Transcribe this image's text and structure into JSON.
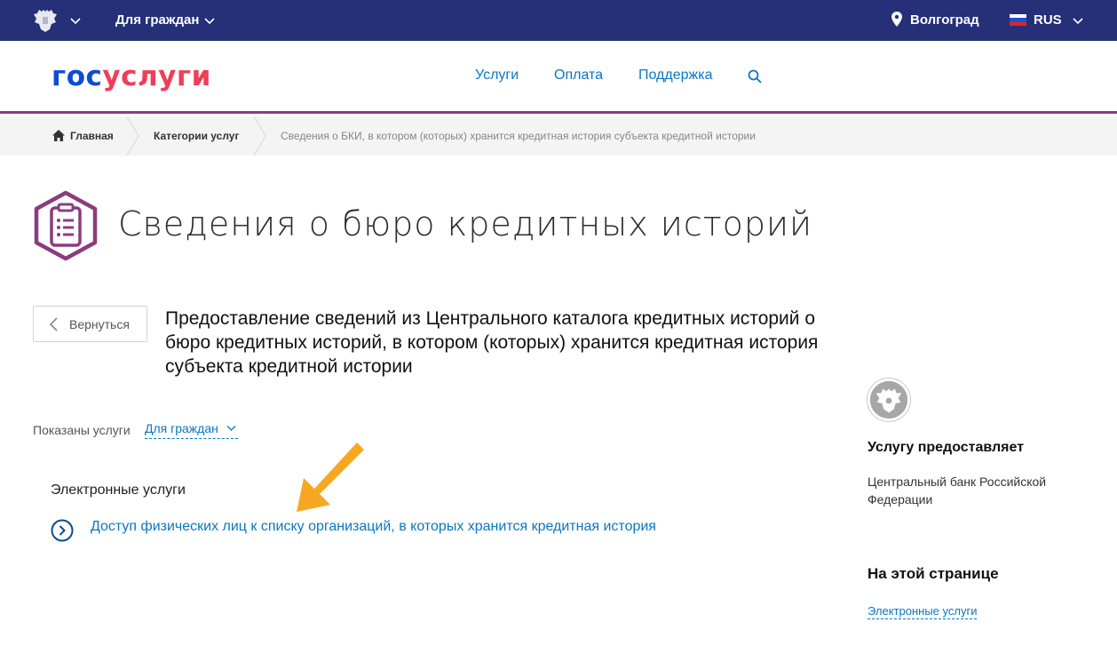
{
  "topbar": {
    "audience": "Для граждан",
    "location": "Волгоград",
    "language": "RUS"
  },
  "header": {
    "logo_part1": "гос",
    "logo_part2": "услуги",
    "nav": [
      "Услуги",
      "Оплата",
      "Поддержка"
    ]
  },
  "breadcrumbs": {
    "home": "Главная",
    "categories": "Категории услуг",
    "current": "Сведения о БКИ, в котором (которых) хранится кредитная история субъекта кредитной истории"
  },
  "page": {
    "title": "Сведения о бюро кредитных историй",
    "back_label": "Вернуться",
    "service_title": "Предоставление сведений из Центрального каталога кредитных историй о бюро кредитных историй, в котором (которых) хранится кредитная история субъекта кредитной истории",
    "shown_label": "Показаны услуги",
    "shown_value": "Для граждан",
    "section_heading": "Электронные услуги",
    "service_link": "Доступ физических лиц к списку организаций, в которых хранится кредитная история"
  },
  "sidebar": {
    "provider_heading": "Услугу предоставляет",
    "provider_name": "Центральный банк Российской Федерации",
    "on_page_heading": "На этой странице",
    "on_page_link": "Электронные услуги"
  },
  "colors": {
    "topbar": "#253078",
    "accent_purple": "#8c3c7e",
    "link_blue": "#0b76c2",
    "logo_blue": "#0d4cd3",
    "logo_red": "#ee3f58",
    "arrow_orange": "#f7a823"
  },
  "icons": {
    "emblem": "coat-of-arms-icon",
    "location": "location-pin-icon",
    "search": "search-icon",
    "home": "home-icon",
    "title": "clipboard-list-icon",
    "service": "chevron-circle-right-icon"
  }
}
